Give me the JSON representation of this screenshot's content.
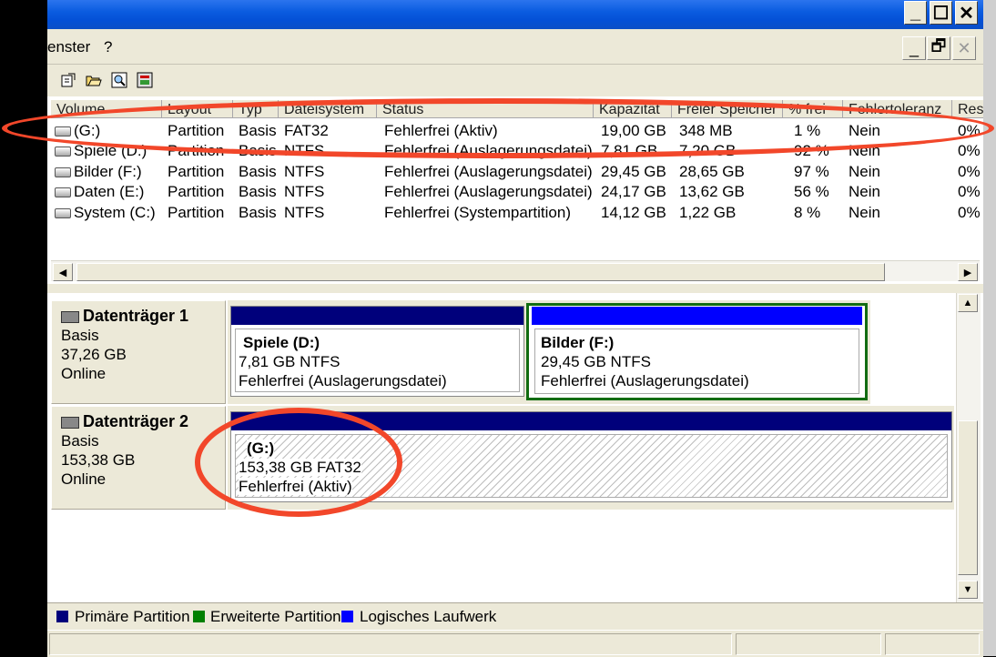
{
  "window": {
    "title": ""
  },
  "titlebar_buttons": {
    "minimize": "_",
    "maximize": "☐",
    "close": "✕"
  },
  "menu": {
    "items": [
      "enster",
      "?"
    ]
  },
  "mdi_buttons": {
    "minimize": "_",
    "restore": "🗗",
    "close": "✕"
  },
  "toolbar": {
    "icons": [
      "properties-icon",
      "open-folder-icon",
      "search-icon",
      "settings-icon"
    ]
  },
  "list": {
    "headers": [
      "Volume",
      "Layout",
      "Typ",
      "Dateisystem",
      "Status",
      "Kapazität",
      "Freier Speicher",
      "% frei",
      "Fehlertoleranz",
      "Res"
    ],
    "rows": [
      {
        "volume": "(G:)",
        "layout": "Partition",
        "typ": "Basis",
        "fs": "FAT32",
        "status": "Fehlerfrei (Aktiv)",
        "cap": "19,00 GB",
        "free": "348 MB",
        "pct": "1 %",
        "ft": "Nein",
        "res": "0%"
      },
      {
        "volume": "Spiele (D:)",
        "layout": "Partition",
        "typ": "Basis",
        "fs": "NTFS",
        "status": "Fehlerfrei (Auslagerungsdatei)",
        "cap": "7,81 GB",
        "free": "7,20 GB",
        "pct": "92 %",
        "ft": "Nein",
        "res": "0%"
      },
      {
        "volume": "Bilder  (F:)",
        "layout": "Partition",
        "typ": "Basis",
        "fs": "NTFS",
        "status": "Fehlerfrei (Auslagerungsdatei)",
        "cap": "29,45 GB",
        "free": "28,65 GB",
        "pct": "97 %",
        "ft": "Nein",
        "res": "0%"
      },
      {
        "volume": "Daten (E:)",
        "layout": "Partition",
        "typ": "Basis",
        "fs": "NTFS",
        "status": "Fehlerfrei (Auslagerungsdatei)",
        "cap": "24,17 GB",
        "free": "13,62 GB",
        "pct": "56 %",
        "ft": "Nein",
        "res": "0%"
      },
      {
        "volume": "System (C:)",
        "layout": "Partition",
        "typ": "Basis",
        "fs": "NTFS",
        "status": "Fehlerfrei (Systempartition)",
        "cap": "14,12 GB",
        "free": "1,22 GB",
        "pct": "8 %",
        "ft": "Nein",
        "res": "0%"
      }
    ]
  },
  "disks": [
    {
      "name": "Datenträger 1",
      "type": "Basis",
      "size": "37,26 GB",
      "state": "Online",
      "partitions": [
        {
          "name": "Spiele  (D:)",
          "size_fs": "7,81 GB NTFS",
          "status": "Fehlerfrei (Auslagerungsdatei)"
        },
        {
          "name": "Bilder   (F:)",
          "size_fs": "29,45 GB NTFS",
          "status": "Fehlerfrei (Auslagerungsdatei)"
        }
      ]
    },
    {
      "name": "Datenträger 2",
      "type": "Basis",
      "size": "153,38 GB",
      "state": "Online",
      "partitions": [
        {
          "name": "(G:)",
          "size_fs": "153,38 GB FAT32",
          "status": "Fehlerfrei (Aktiv)"
        }
      ]
    }
  ],
  "legend": [
    {
      "label": "Primäre Partition",
      "color": "#00007b"
    },
    {
      "label": "Erweiterte Partition",
      "color": "#008000"
    },
    {
      "label": "Logisches Laufwerk",
      "color": "#0000ff"
    }
  ],
  "colors": {
    "annotation": "#f2472a",
    "titlebar": "#0a5ce0",
    "primary": "#00007b",
    "logical": "#0000ff",
    "extended": "#008000"
  }
}
